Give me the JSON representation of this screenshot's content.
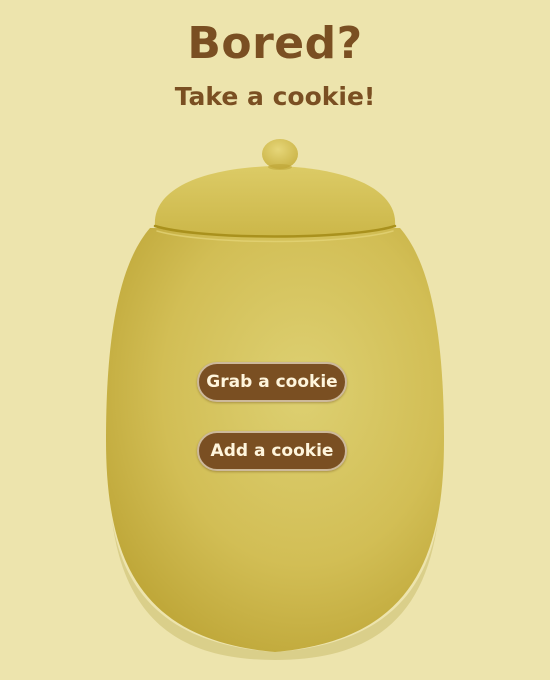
{
  "page": {
    "title": "Bored?",
    "subtitle": "Take a cookie!"
  },
  "jar": {
    "icon": "cookie-jar-icon",
    "body_color": "#d4c25a",
    "lid_color": "#d9c762",
    "outline_color": "#a9911d"
  },
  "actions": {
    "grab_label": "Grab a cookie",
    "add_label": "Add a cookie"
  },
  "colors": {
    "background": "#ede4ad",
    "text": "#7a4f22",
    "button_bg": "#7a4f22",
    "button_text": "#fff5dc"
  }
}
